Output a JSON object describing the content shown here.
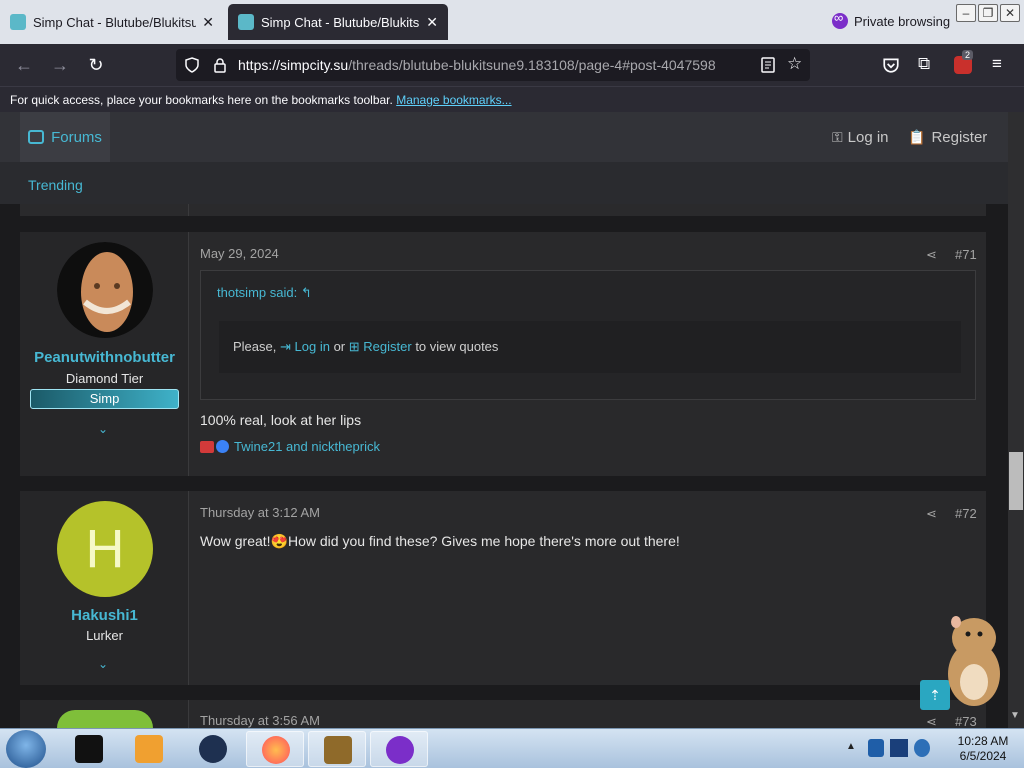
{
  "browser": {
    "tabs": [
      {
        "title": "Simp Chat - Blutube/Blukitsune",
        "active": false
      },
      {
        "title": "Simp Chat - Blutube/Blukitsune",
        "active": true
      }
    ],
    "private_label": "Private browsing",
    "url_host": "https://simpcity.su",
    "url_path": "/threads/blutube-blukitsune9.183108/page-4#post-4047598",
    "extensions_badge": "2",
    "bookmarks_text": "For quick access, place your bookmarks here on the bookmarks toolbar.",
    "bookmarks_link": "Manage bookmarks..."
  },
  "site": {
    "forums_label": "Forums",
    "login_label": "Log in",
    "register_label": "Register",
    "trending_label": "Trending"
  },
  "posts": [
    {
      "username": "Peanutwithnobutter",
      "user_title": "Diamond Tier",
      "banner": "Simp",
      "date": "May 29, 2024",
      "number": "#71",
      "quote": {
        "author": "thotsimp said:",
        "prefix": "Please,",
        "login": "Log in",
        "or": "or",
        "register": "Register",
        "suffix": "to view quotes"
      },
      "text": "100% real, look at her lips",
      "reactions": "Twine21 and nicktheprick"
    },
    {
      "username": "Hakushi1",
      "user_title": "Lurker",
      "avatar_letter": "H",
      "date": "Thursday at 3:12 AM",
      "number": "#72",
      "text_before": "Wow great!",
      "emoji": "😍",
      "text_after": "How did you find these? Gives me hope there's more out there!"
    },
    {
      "date": "Thursday at 3:56 AM",
      "number": "#73"
    }
  ],
  "taskbar": {
    "time": "10:28 AM",
    "date": "6/5/2024"
  },
  "colors": {
    "accent": "#47b8d3",
    "page_bg": "#1b1b1d",
    "post_bg": "#29292b",
    "avatar_h": "#b5c22a"
  }
}
